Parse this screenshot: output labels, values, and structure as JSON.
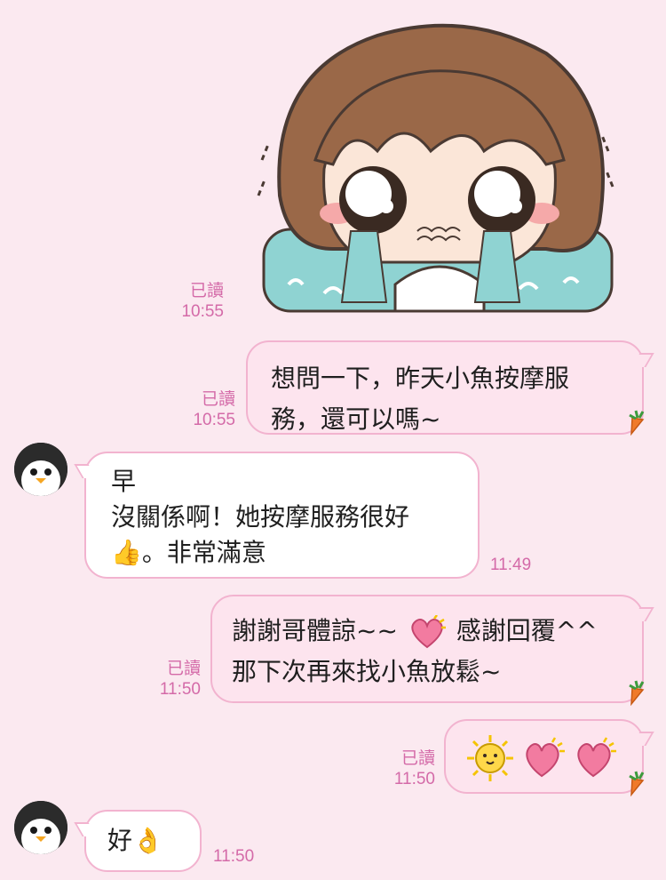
{
  "messages": {
    "m1": {
      "read": "已讀",
      "time": "10:55",
      "sticker": "crying-girl-sticker"
    },
    "m2": {
      "read": "已讀",
      "time": "10:55",
      "line1": "想問一下，昨天小魚按摩服",
      "line2": "務，還可以嗎~"
    },
    "m3": {
      "time": "11:49",
      "line1": "早",
      "line2": "沒關係啊！她按摩服務很好",
      "line3_emoji": "👍",
      "line3_text": "。非常滿意"
    },
    "m4": {
      "read": "已讀",
      "time": "11:50",
      "line1_a": "謝謝哥體諒~~",
      "line1_b": "感謝回覆^^",
      "line2": "那下次再來找小魚放鬆~"
    },
    "m5": {
      "read": "已讀",
      "time": "11:50",
      "stickers": [
        "sun-emoji",
        "heart-emoji",
        "heart-emoji"
      ]
    },
    "m6": {
      "time": "11:50",
      "text": "好",
      "emoji": "👌"
    }
  },
  "colors": {
    "background": "#fbe9f0",
    "meta": "#d46aa8",
    "bubble_out": "#fde4ee",
    "bubble_in": "#ffffff",
    "border": "#f2b3cf"
  }
}
